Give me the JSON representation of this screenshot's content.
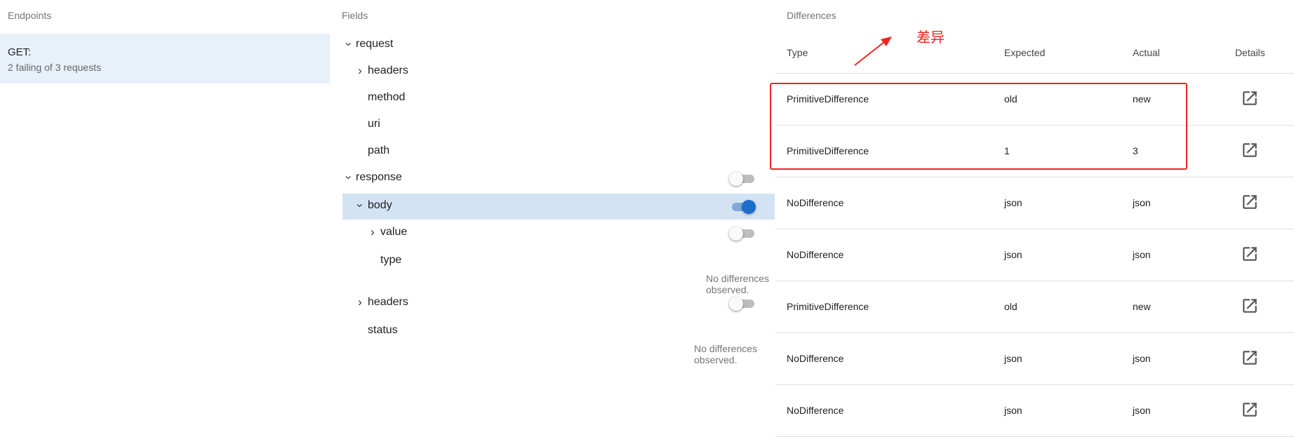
{
  "endpoints": {
    "title": "Endpoints",
    "items": [
      {
        "method": "GET:",
        "status": "2 failing of 3 requests"
      }
    ]
  },
  "fields": {
    "title": "Fields",
    "rows": [
      {
        "label": "request",
        "expander": "expanded"
      },
      {
        "label": "headers",
        "expander": "collapsed"
      },
      {
        "label": "method"
      },
      {
        "label": "uri"
      },
      {
        "label": "path"
      },
      {
        "label": "response",
        "expander": "expanded",
        "toggle": "off"
      },
      {
        "label": "body",
        "expander": "expanded",
        "toggle": "on",
        "selected": true
      },
      {
        "label": "value",
        "expander": "collapsed",
        "toggle": "off"
      },
      {
        "label": "type",
        "note": "No differences observed."
      },
      {
        "label": "headers",
        "expander": "collapsed",
        "toggle": "off"
      },
      {
        "label": "status",
        "note": "No differences observed."
      }
    ]
  },
  "differences": {
    "title": "Differences",
    "columns": [
      "Type",
      "Expected",
      "Actual",
      "Details"
    ],
    "rows": [
      {
        "type": "PrimitiveDifference",
        "expected": "old",
        "actual": "new",
        "details_icon": "open-in-new-icon"
      },
      {
        "type": "PrimitiveDifference",
        "expected": "1",
        "actual": "3",
        "details_icon": "open-in-new-icon"
      },
      {
        "type": "NoDifference",
        "expected": "json",
        "actual": "json",
        "details_icon": "open-in-new-icon"
      },
      {
        "type": "NoDifference",
        "expected": "json",
        "actual": "json",
        "details_icon": "open-in-new-icon"
      },
      {
        "type": "PrimitiveDifference",
        "expected": "old",
        "actual": "new",
        "details_icon": "open-in-new-icon"
      },
      {
        "type": "NoDifference",
        "expected": "json",
        "actual": "json",
        "details_icon": "open-in-new-icon"
      },
      {
        "type": "NoDifference",
        "expected": "json",
        "actual": "json",
        "details_icon": "open-in-new-icon"
      }
    ]
  },
  "annotation": {
    "label": "差异",
    "color": "#f0241c"
  },
  "colors": {
    "selected_row": "#d3e3f4",
    "endpoint_selected": "#e8f0fa",
    "toggle_on": "#1a6fce"
  }
}
